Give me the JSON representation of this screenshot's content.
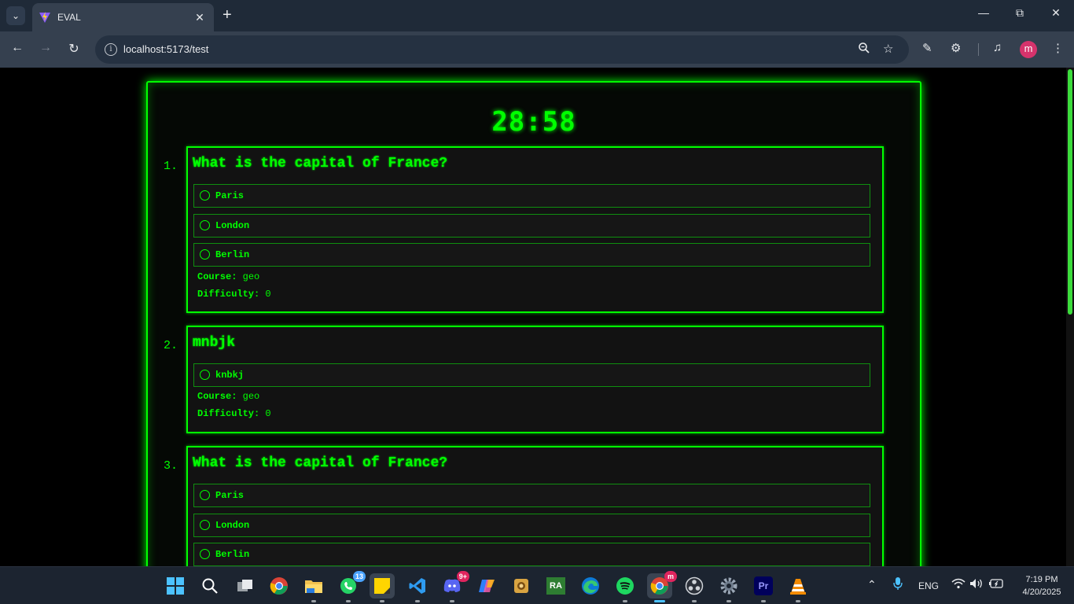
{
  "browser": {
    "tab_title": "EVAL",
    "url": "localhost:5173/test",
    "new_tab": "+",
    "avatar_letter": "m"
  },
  "page": {
    "timer": "28:58",
    "questions": [
      {
        "number": "1.",
        "title": "What is the capital of France?",
        "options": [
          "Paris",
          "London",
          "Berlin"
        ],
        "course_label": "Course:",
        "course": "geo",
        "difficulty_label": "Difficulty:",
        "difficulty": "0"
      },
      {
        "number": "2.",
        "title": "mnbjk",
        "options": [
          "knbkj"
        ],
        "course_label": "Course:",
        "course": "geo",
        "difficulty_label": "Difficulty:",
        "difficulty": "0"
      },
      {
        "number": "3.",
        "title": "What is the capital of France?",
        "options": [
          "Paris",
          "London",
          "Berlin"
        ]
      }
    ]
  },
  "taskbar": {
    "apps": [
      "start",
      "search",
      "task-view",
      "chrome",
      "file-explorer",
      "whatsapp",
      "sticky-notes",
      "vscode",
      "discord",
      "copilot",
      "image-viewer",
      "ra-app",
      "edge",
      "spotify",
      "chrome-profile",
      "obs",
      "settings",
      "premiere-pro",
      "vlc"
    ],
    "whatsapp_badge": "13",
    "discord_badge": "9+",
    "chrome_badge": "m",
    "ra_label": "RA",
    "premiere_label": "Pr",
    "language": "ENG",
    "time": "7:19 PM",
    "date": "4/20/2025"
  },
  "colors": {
    "accent": "#00ff00",
    "card_bg": "#121212",
    "page_bg": "#000000"
  }
}
